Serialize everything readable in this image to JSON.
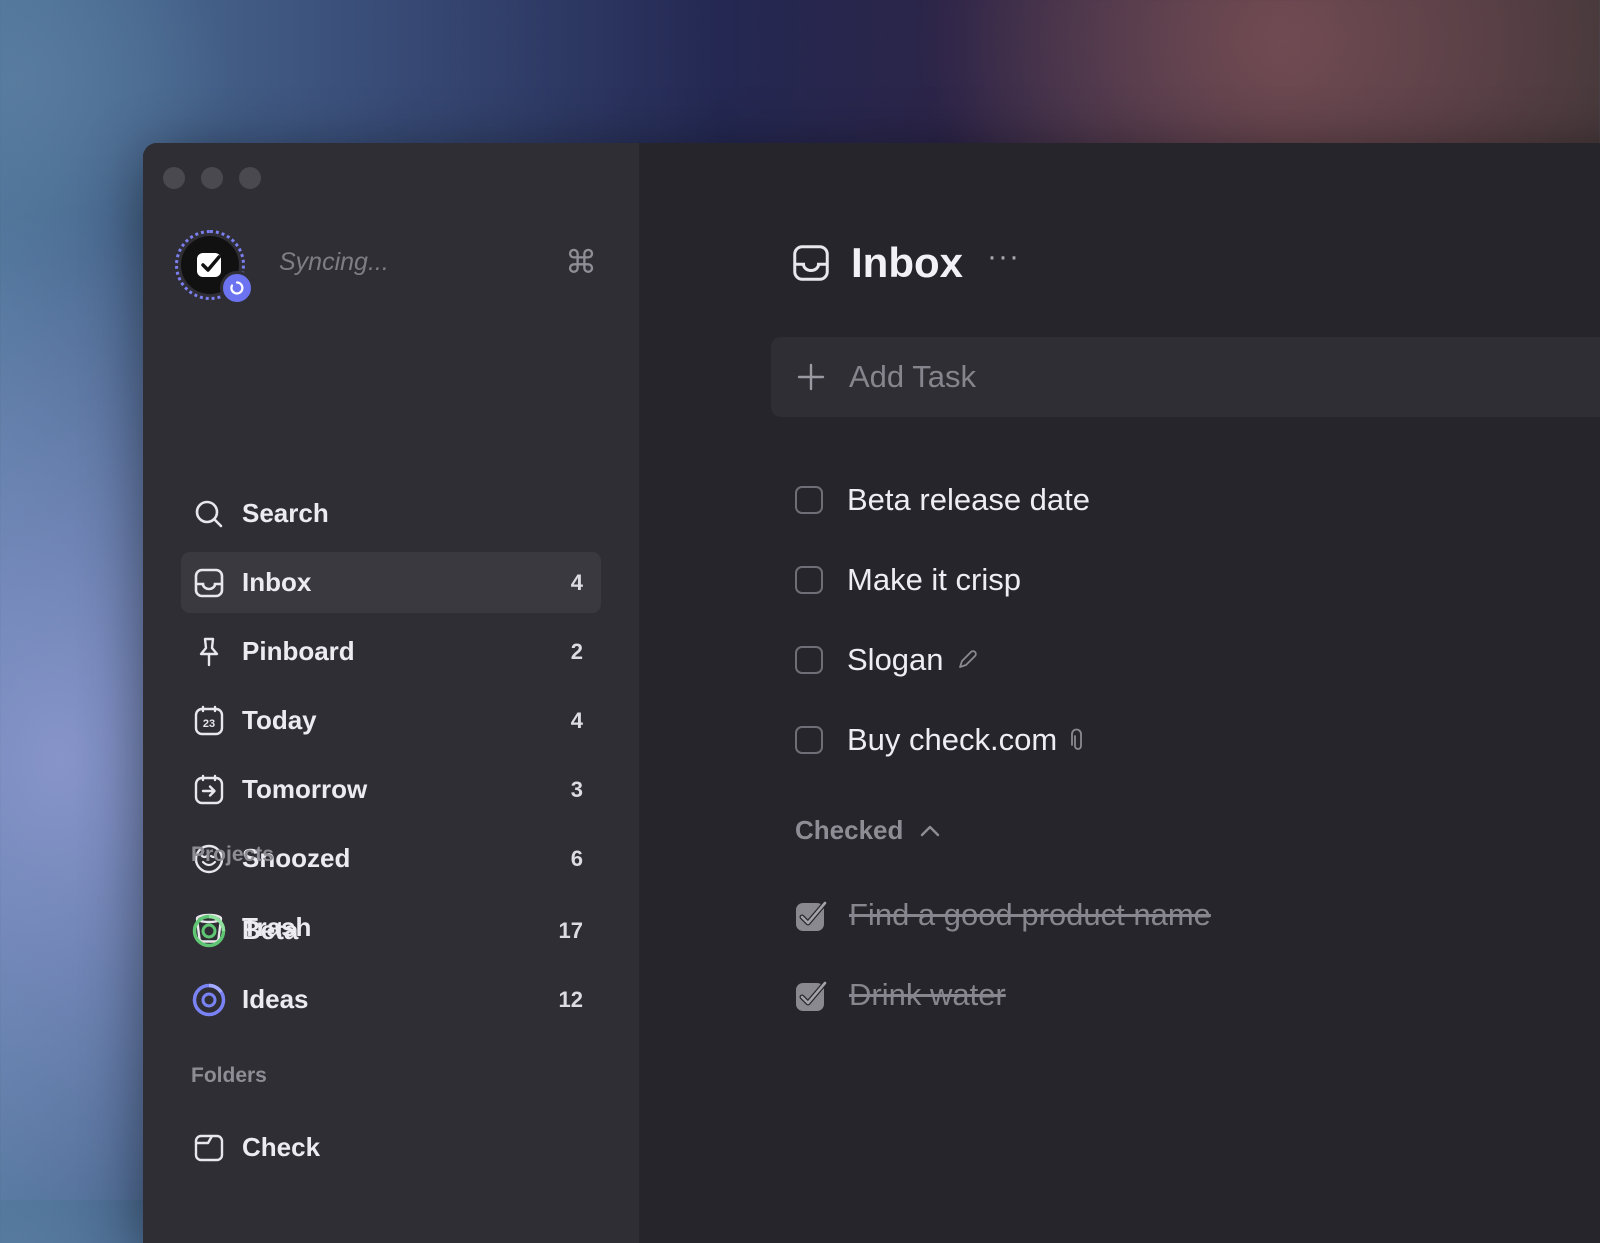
{
  "window": {
    "sync_status": "Syncing...",
    "command_icon": "⌘"
  },
  "sidebar": {
    "items": [
      {
        "label": "Search",
        "count": "",
        "icon": "search-icon"
      },
      {
        "label": "Inbox",
        "count": "4",
        "icon": "inbox-icon",
        "active": true
      },
      {
        "label": "Pinboard",
        "count": "2",
        "icon": "pin-icon"
      },
      {
        "label": "Today",
        "count": "4",
        "icon": "calendar-today-icon",
        "day": "23"
      },
      {
        "label": "Tomorrow",
        "count": "3",
        "icon": "calendar-tomorrow-icon"
      },
      {
        "label": "Snoozed",
        "count": "6",
        "icon": "snooze-face-icon"
      },
      {
        "label": "Trash",
        "count": "",
        "icon": "trash-icon"
      }
    ],
    "projects_title": "Projects",
    "projects": [
      {
        "label": "Beta",
        "count": "17",
        "color": "#5fc774"
      },
      {
        "label": "Ideas",
        "count": "12",
        "color": "#7a83f5"
      }
    ],
    "folders_title": "Folders",
    "folders": [
      {
        "label": "Check",
        "icon": "folder-icon"
      }
    ]
  },
  "main": {
    "title": "Inbox",
    "more": "···",
    "add_task_placeholder": "Add Task",
    "tasks": [
      {
        "text": "Beta release date"
      },
      {
        "text": "Make it crisp"
      },
      {
        "text": "Slogan",
        "meta_icon": "pencil-icon"
      },
      {
        "text": "Buy check.com",
        "meta_icon": "paperclip-icon"
      }
    ],
    "checked_label": "Checked",
    "checked_tasks": [
      {
        "text": "Find a good product name"
      },
      {
        "text": "Drink water"
      }
    ]
  },
  "colors": {
    "accent": "#6b73f0",
    "sidebar_bg": "#2f2e34",
    "main_bg": "#26252b"
  }
}
